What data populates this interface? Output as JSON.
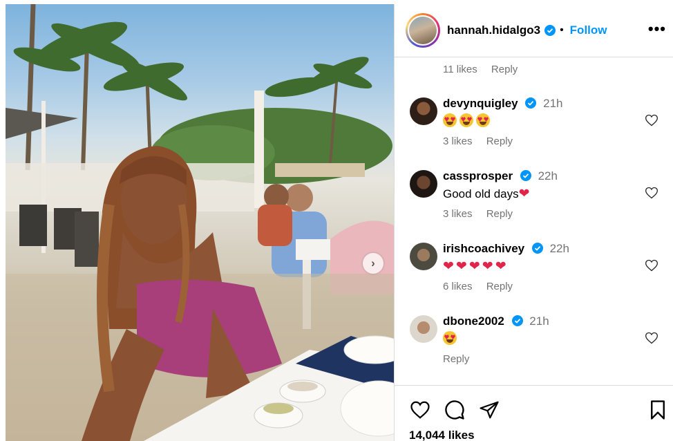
{
  "post": {
    "image_alt": "Woman in a pink strapless top sitting at a beachside restaurant table with palm trees"
  },
  "header": {
    "username": "hannah.hidalgo3",
    "follow_label": "Follow",
    "more_icon": "more-icon"
  },
  "top_comment_meta": {
    "likes": "11 likes",
    "reply": "Reply"
  },
  "comments": [
    {
      "user": "devynquigley",
      "verified": true,
      "time": "21h",
      "text": "",
      "emoji": "heart-eyes x3",
      "likes": "3 likes",
      "reply": "Reply"
    },
    {
      "user": "cassprosper",
      "verified": true,
      "time": "22h",
      "text": "Good old days",
      "emoji": "red-heart",
      "likes": "3 likes",
      "reply": "Reply"
    },
    {
      "user": "irishcoachivey",
      "verified": true,
      "time": "22h",
      "text": "",
      "emoji": "red-heart x5",
      "likes": "6 likes",
      "reply": "Reply"
    },
    {
      "user": "dbone2002",
      "verified": true,
      "time": "21h",
      "text": "",
      "emoji": "heart-eyes",
      "likes": "",
      "reply": "Reply"
    }
  ],
  "footer": {
    "likes_count": "14,044 likes"
  },
  "colors": {
    "accent": "#0095f6",
    "muted": "#737373",
    "border": "#dbdbdb"
  }
}
